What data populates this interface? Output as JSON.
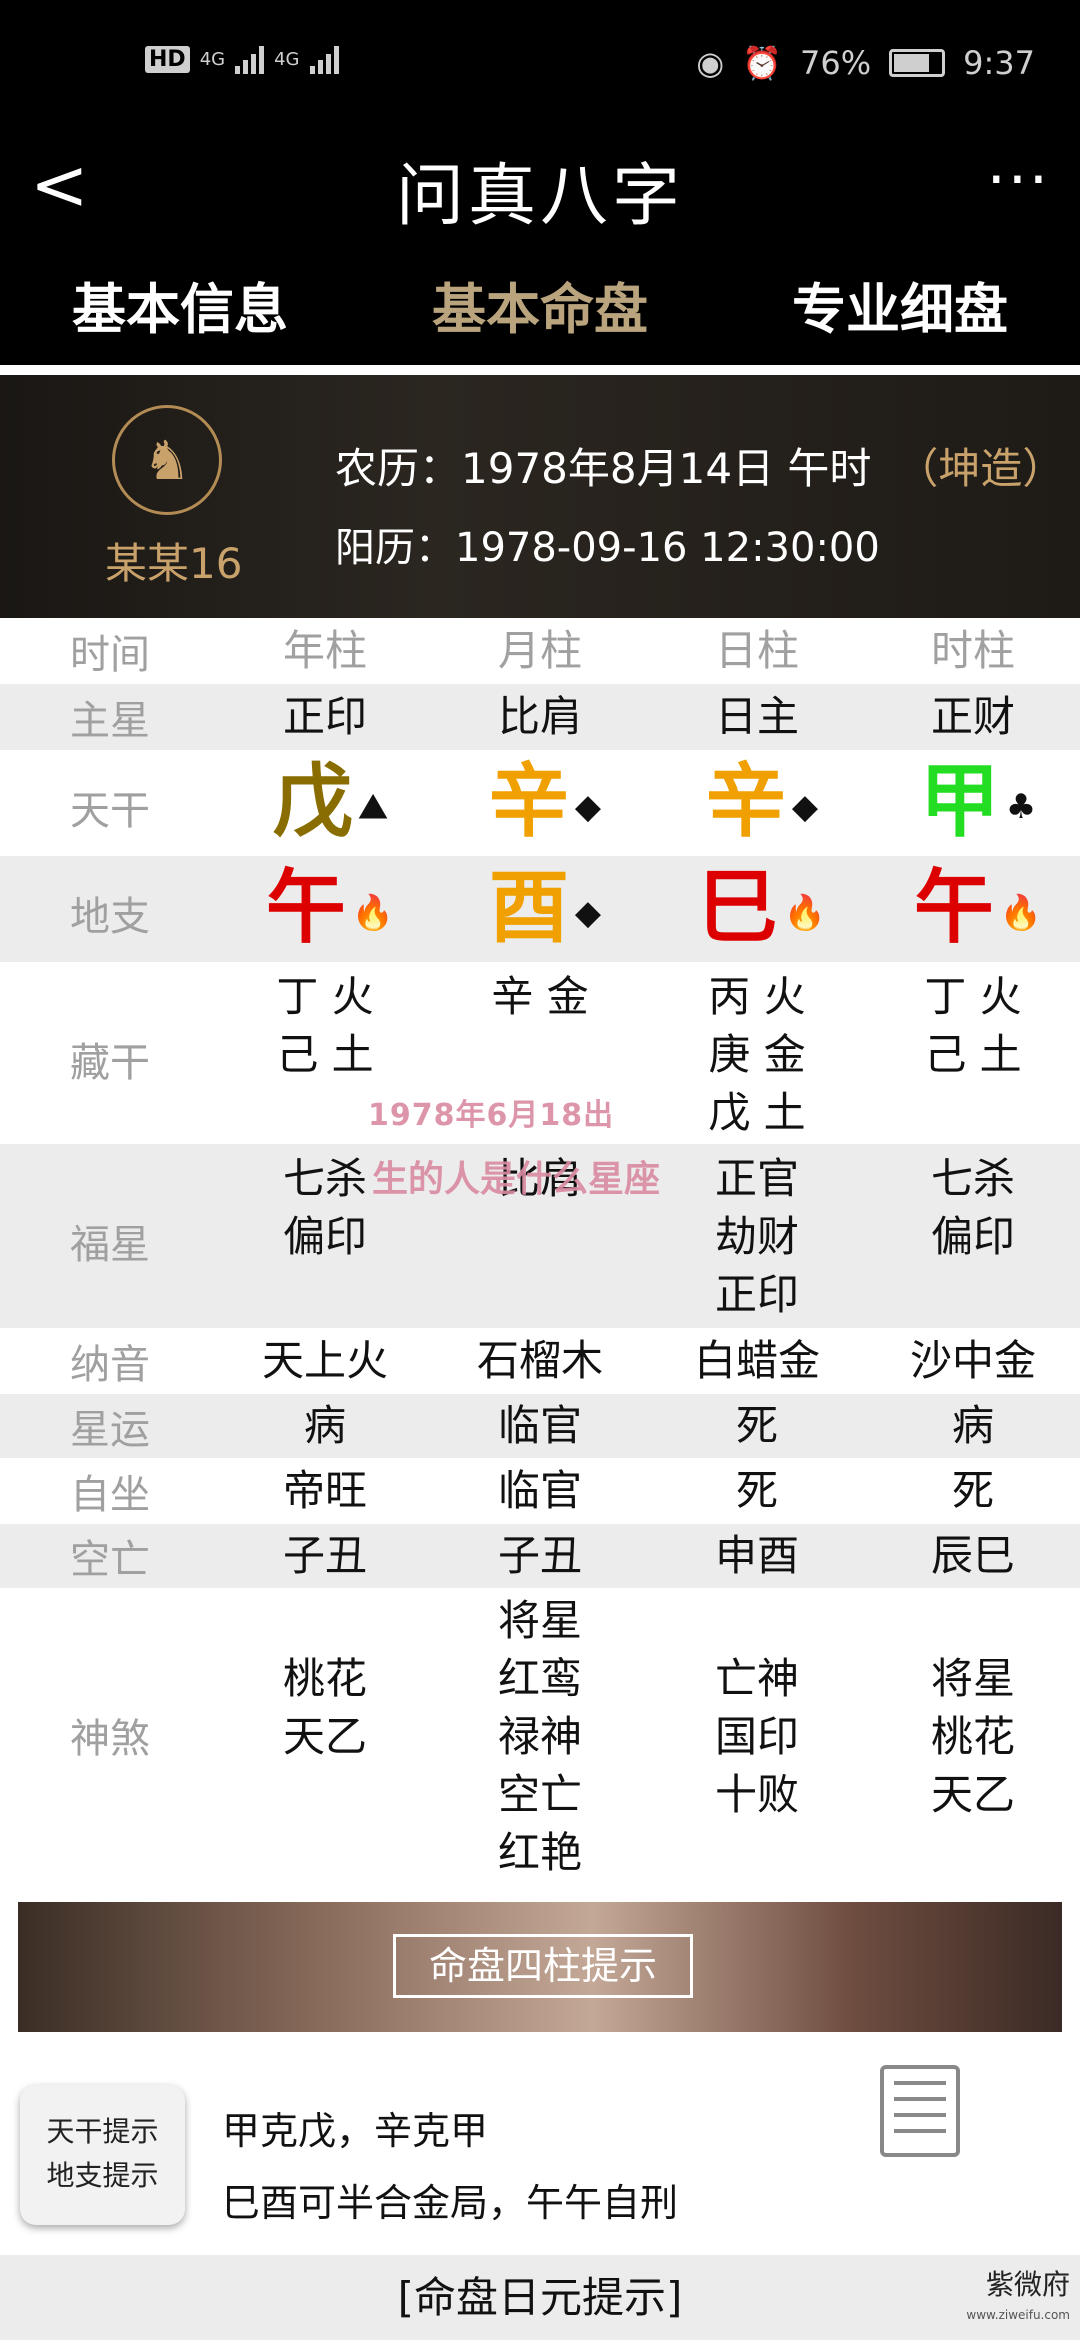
{
  "status": {
    "net1": "4G",
    "net2": "4G",
    "battery": "76%",
    "time": "9:37",
    "hd": "HD"
  },
  "nav": {
    "title": "问真八字",
    "back": "<",
    "more": "···"
  },
  "tabs": [
    {
      "label": "基本信息"
    },
    {
      "label": "基本命盘"
    },
    {
      "label": "专业细盘"
    }
  ],
  "profile": {
    "name": "某某16",
    "lunar_label": "农历：",
    "lunar": "1978年8月14日 午时",
    "gender": "（坤造）",
    "solar_label": "阳历：",
    "solar": "1978-09-16 12:30:00"
  },
  "table": {
    "head": {
      "label": "时间",
      "cols": [
        "年柱",
        "月柱",
        "日柱",
        "时柱"
      ]
    },
    "main_star": {
      "label": "主星",
      "cols": [
        "正印",
        "比肩",
        "日主",
        "正财"
      ]
    },
    "stem": {
      "label": "天干",
      "cols": [
        "戊",
        "辛",
        "辛",
        "甲"
      ],
      "colors": [
        "#8a6d00",
        "#f0a000",
        "#f0a000",
        "#22dd22"
      ]
    },
    "branch": {
      "label": "地支",
      "cols": [
        "午",
        "酉",
        "巳",
        "午"
      ],
      "colors": [
        "#dd0000",
        "#f0a000",
        "#dd0000",
        "#dd0000"
      ]
    },
    "hidden": {
      "label": "藏干",
      "cols": [
        [
          "丁 火",
          "己 土"
        ],
        [
          "辛 金"
        ],
        [
          "丙 火",
          "庚 金",
          "戊 土"
        ],
        [
          "丁 火",
          "己 土"
        ]
      ]
    },
    "fortune": {
      "label": "福星",
      "cols": [
        [
          "七杀",
          "偏印"
        ],
        [
          "比肩"
        ],
        [
          "正官",
          "劫财",
          "正印"
        ],
        [
          "七杀",
          "偏印"
        ]
      ]
    },
    "nayin": {
      "label": "纳音",
      "cols": [
        "天上火",
        "石榴木",
        "白蜡金",
        "沙中金"
      ]
    },
    "xingyun": {
      "label": "星运",
      "cols": [
        "病",
        "临官",
        "死",
        "病"
      ]
    },
    "zizuo": {
      "label": "自坐",
      "cols": [
        "帝旺",
        "临官",
        "死",
        "死"
      ]
    },
    "kongwang": {
      "label": "空亡",
      "cols": [
        "子丑",
        "子丑",
        "申酉",
        "辰巳"
      ]
    },
    "shensha": {
      "label": "神煞",
      "cols": [
        [
          "桃花",
          "天乙"
        ],
        [
          "将星",
          "红鸾",
          "禄神",
          "空亡",
          "红艳"
        ],
        [
          "亡神",
          "国印",
          "十败"
        ],
        [
          "将星",
          "桃花",
          "天乙"
        ]
      ]
    }
  },
  "banner": {
    "label": "命盘四柱提示"
  },
  "hints": {
    "btn1": "天干提示",
    "btn2": "地支提示",
    "text1": "甲克戊，辛克甲",
    "text2": "巳酉可半合金局，午午自刑"
  },
  "footer": {
    "label": "[命盘日元提示]"
  },
  "watermark": {
    "line1": "1978年6月18出",
    "line2": "生的人是什么星座"
  },
  "logo": {
    "text": "紫微府",
    "url": "www.ziweifu.com"
  }
}
